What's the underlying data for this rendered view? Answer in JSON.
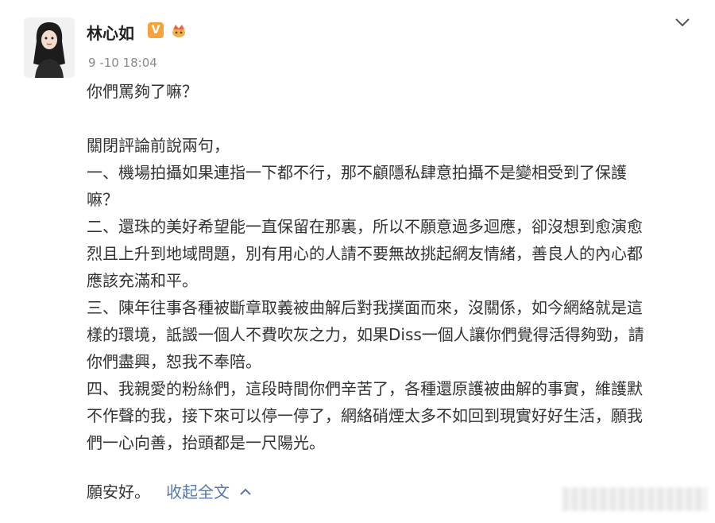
{
  "header": {
    "user_name": "林心如",
    "verified_badge": "V",
    "crown_icon": "crown-emoji-icon",
    "timestamp": "9 -10 18:04",
    "menu_icon": "chevron-down-icon"
  },
  "post": {
    "lines": [
      "你們罵夠了嘛？",
      "",
      "關閉評論前說兩句，",
      "一、機場拍攝如果連指一下都不行，那不顧隱私肆意拍攝不是變相受到了保護\n嘛？",
      "二、還珠的美好希望能一直保留在那裏，所以不願意過多迴應，卻沒想到愈演愈\n烈且上升到地域問題，別有用心的人請不要無故挑起網友情緒，善良人的內心都\n應該充滿和平。",
      "三、陳年往事各種被斷章取義被曲解后對我撲面而來，沒關係，如今網絡就是這\n樣的環境，詆譭一個人不費吹灰之力，如果Diss一個人讓你們覺得活得夠勁，請\n你們盡興，恕我不奉陪。",
      "四、我親愛的粉絲們，這段時間你們辛苦了，各種還原護被曲解的事實，維護默\n不作聲的我，接下來可以停一停了，網絡硝煙太多不如回到現實好好生活，願我\n們一心向善，抬頭都是一尺陽光。"
    ]
  },
  "footer": {
    "closing": "願安好。",
    "collapse_label": "收起全文",
    "collapse_icon": "chevron-up-icon"
  },
  "colors": {
    "link": "#5778a8",
    "text": "#333333",
    "meta": "#8a8a8a",
    "badge": "#f6a33a"
  }
}
